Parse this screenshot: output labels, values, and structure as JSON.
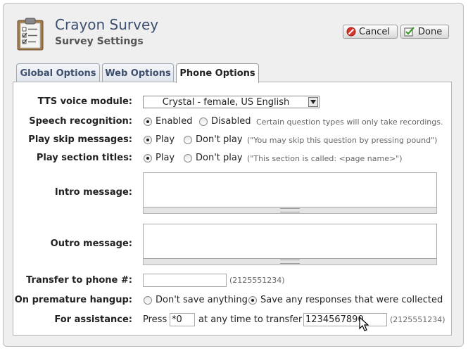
{
  "header": {
    "title": "Crayon Survey",
    "subtitle": "Survey Settings",
    "cancel_label": "Cancel",
    "done_label": "Done"
  },
  "tabs": [
    {
      "label": "Global Options",
      "active": false
    },
    {
      "label": "Web Options",
      "active": false
    },
    {
      "label": "Phone Options",
      "active": true
    }
  ],
  "form": {
    "tts": {
      "label": "TTS voice module:",
      "selected": "Crystal - female, US English"
    },
    "speech": {
      "label": "Speech recognition:",
      "opt_on": "Enabled",
      "opt_off": "Disabled",
      "selected": "Enabled",
      "hint": "Certain question types will only take recordings."
    },
    "skip": {
      "label": "Play skip messages:",
      "opt_on": "Play",
      "opt_off": "Don't play",
      "selected": "Play",
      "hint": "(\"You may skip this question by pressing pound\")"
    },
    "section": {
      "label": "Play section titles:",
      "opt_on": "Play",
      "opt_off": "Don't play",
      "selected": "Play",
      "hint": "(\"This section is called: <page name>\")"
    },
    "intro": {
      "label": "Intro message:",
      "value": ""
    },
    "outro": {
      "label": "Outro message:",
      "value": ""
    },
    "transfer": {
      "label": "Transfer to phone #:",
      "value": "",
      "hint": "(2125551234)"
    },
    "hangup": {
      "label": "On premature hangup:",
      "opt_a": "Don't save anything",
      "opt_b": "Save any responses that were collected",
      "selected": "Save any responses that were collected"
    },
    "assist": {
      "label": "For assistance:",
      "prefix": "Press",
      "key_value": "*0",
      "middle": "at any time to transfer to:",
      "phone_value": "1234567890",
      "hint": "(2125551234)"
    }
  },
  "colors": {
    "title": "#3d4f6e",
    "cancel_icon": "#d9342b",
    "done_icon": "#3a9a2a"
  }
}
